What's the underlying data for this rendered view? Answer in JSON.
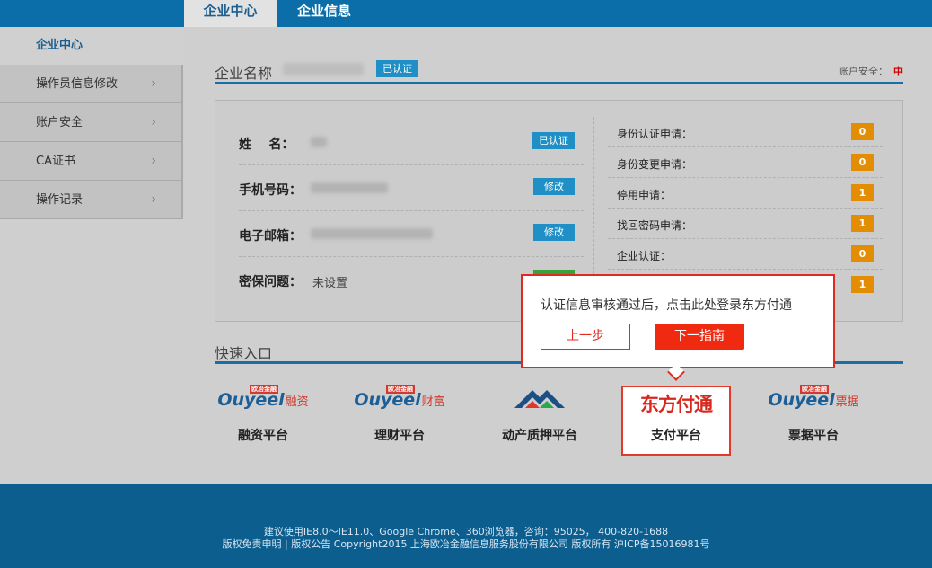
{
  "tabs": [
    "企业中心",
    "企业信息"
  ],
  "sidebar": {
    "head": "企业中心",
    "items": [
      {
        "label": "操作员信息修改"
      },
      {
        "label": "账户安全"
      },
      {
        "label": "CA证书"
      },
      {
        "label": "操作记录"
      }
    ],
    "chevron": "›"
  },
  "company": {
    "label": "企业名称",
    "verified": "已认证",
    "security_label": "账户安全：",
    "security_level": "中"
  },
  "info": {
    "name_label": "姓    名：",
    "name_badge": "已认证",
    "phone_label": "手机号码：",
    "phone_action": "修改",
    "email_label": "电子邮箱：",
    "email_action": "修改",
    "question_label": "密保问题：",
    "question_value": "未设置"
  },
  "stats": [
    {
      "label": "身份认证申请：",
      "count": "0"
    },
    {
      "label": "身份变更申请：",
      "count": "0"
    },
    {
      "label": "停用申请：",
      "count": "1"
    },
    {
      "label": "找回密码申请：",
      "count": "1"
    },
    {
      "label": "企业认证：",
      "count": "0"
    },
    {
      "label": "",
      "count": "1"
    }
  ],
  "quick": {
    "title": "快速入口",
    "platforms": [
      {
        "logo_brand": "Ouyeel",
        "logo_tag": "欧冶金融",
        "logo_cn": "融资",
        "name": "融资平台"
      },
      {
        "logo_brand": "Ouyeel",
        "logo_tag": "欧冶金融",
        "logo_cn": "财富",
        "name": "理财平台"
      },
      {
        "name": "动产质押平台"
      },
      {
        "logo_text": "东方付通",
        "name": "支付平台"
      },
      {
        "logo_brand": "Ouyeel",
        "logo_tag": "欧冶金融",
        "logo_cn": "票据",
        "name": "票据平台"
      }
    ]
  },
  "tooltip": {
    "message": "认证信息审核通过后，点击此处登录东方付通",
    "prev": "上一步",
    "next": "下一指南"
  },
  "footer": {
    "line1": "建议使用IE8.0～IE11.0、Google Chrome、360浏览器，咨询：95025， 400-820-1688",
    "line2": "版权免责申明 | 版权公告 Copyright2015 上海欧冶金融信息服务股份有限公司 版权所有 沪ICP备15016981号"
  },
  "colors": {
    "brand_blue": "#0c6ea8",
    "accent_red": "#e02a20",
    "count_orange": "#e38d05"
  }
}
